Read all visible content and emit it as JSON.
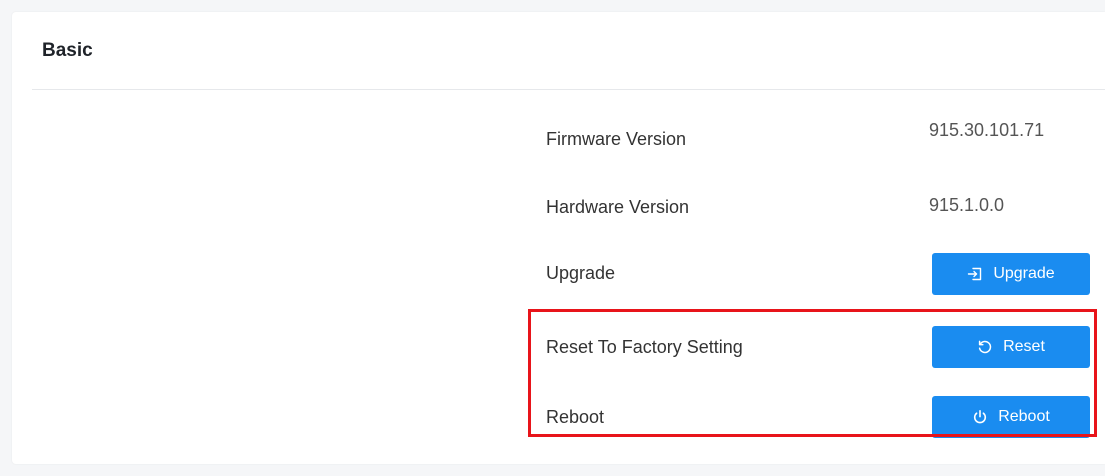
{
  "section": {
    "title": "Basic"
  },
  "rows": {
    "firmware": {
      "label": "Firmware Version",
      "value": "915.30.101.71"
    },
    "hardware": {
      "label": "Hardware Version",
      "value": "915.1.0.0"
    },
    "upgrade": {
      "label": "Upgrade",
      "button_label": "Upgrade",
      "icon": "import-icon"
    },
    "reset": {
      "label": "Reset To Factory Setting",
      "button_label": "Reset",
      "icon": "reset-icon"
    },
    "reboot": {
      "label": "Reboot",
      "button_label": "Reboot",
      "icon": "power-icon"
    }
  },
  "colors": {
    "primary_button": "#1a8cf0",
    "highlight_border": "#e8141a"
  }
}
